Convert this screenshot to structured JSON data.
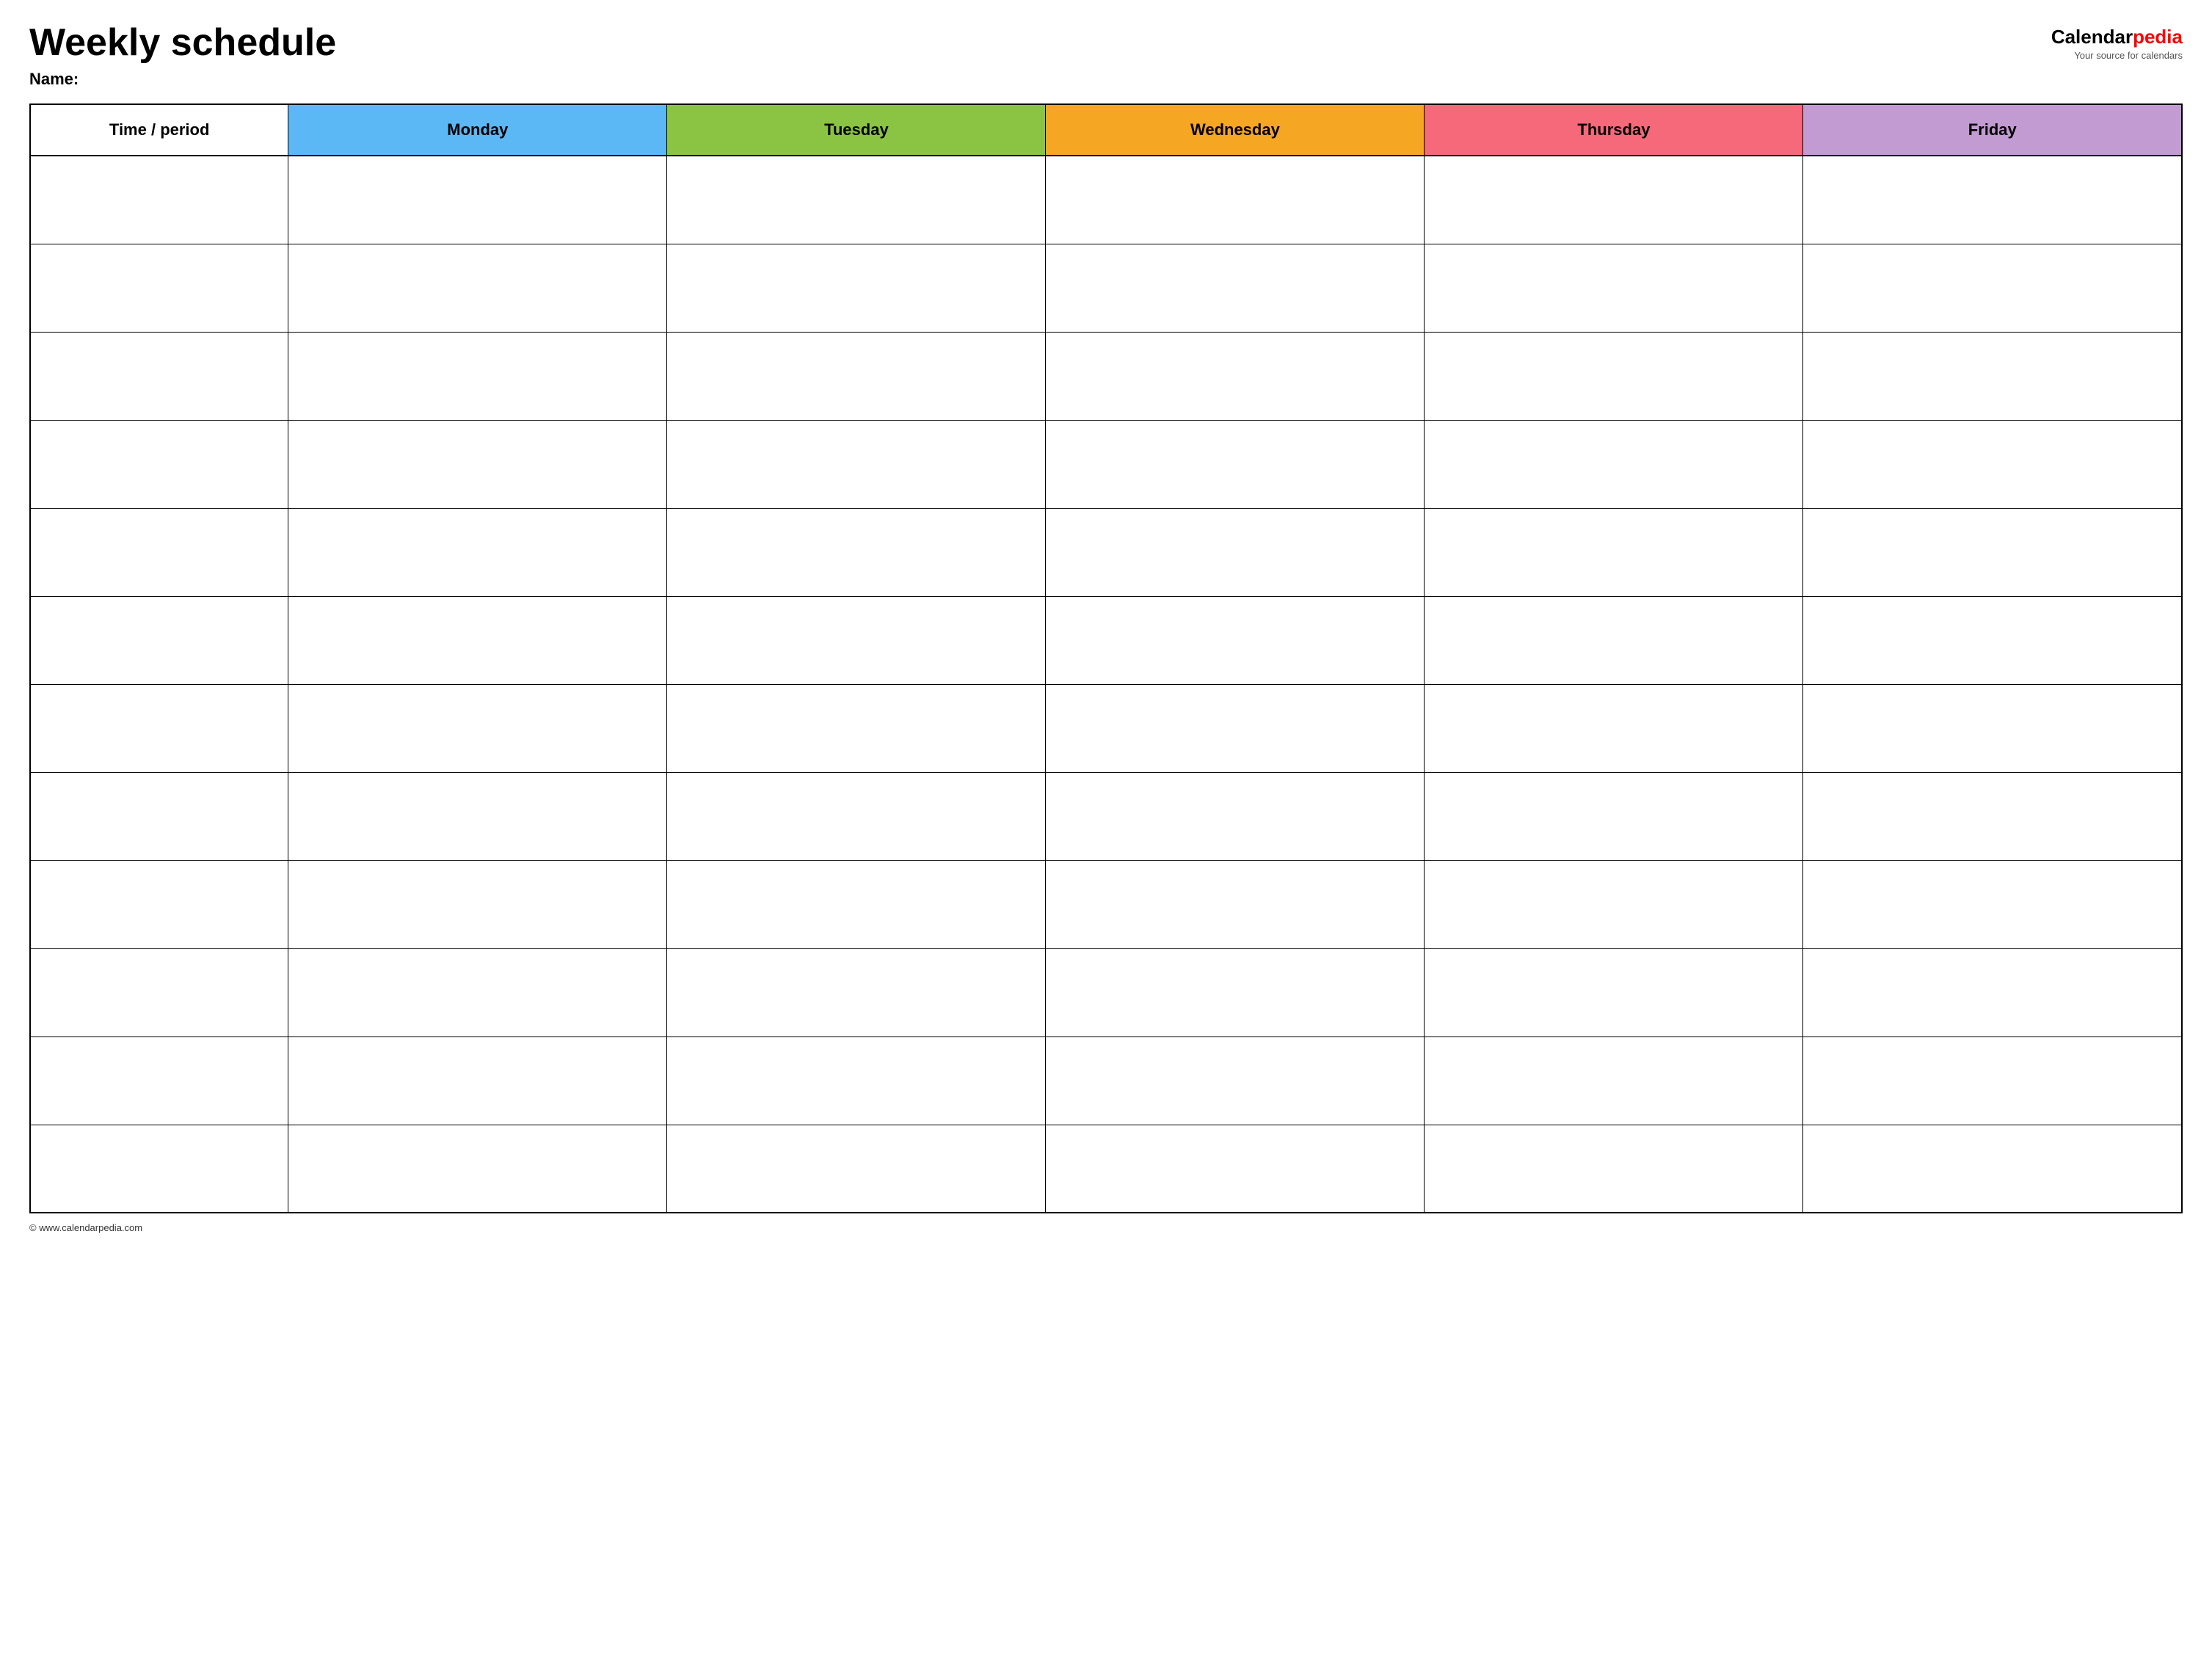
{
  "header": {
    "title": "Weekly schedule",
    "name_label": "Name:",
    "logo": {
      "calendar_text": "Calendar",
      "pedia_text": "pedia",
      "tagline": "Your source for calendars"
    }
  },
  "table": {
    "columns": [
      {
        "id": "time",
        "label": "Time / period",
        "color": "#ffffff"
      },
      {
        "id": "monday",
        "label": "Monday",
        "color": "#5bb8f5"
      },
      {
        "id": "tuesday",
        "label": "Tuesday",
        "color": "#8ac442"
      },
      {
        "id": "wednesday",
        "label": "Wednesday",
        "color": "#f5a623"
      },
      {
        "id": "thursday",
        "label": "Thursday",
        "color": "#f5697a"
      },
      {
        "id": "friday",
        "label": "Friday",
        "color": "#c39bd3"
      }
    ],
    "row_count": 12
  },
  "footer": {
    "url": "© www.calendarpedia.com"
  }
}
